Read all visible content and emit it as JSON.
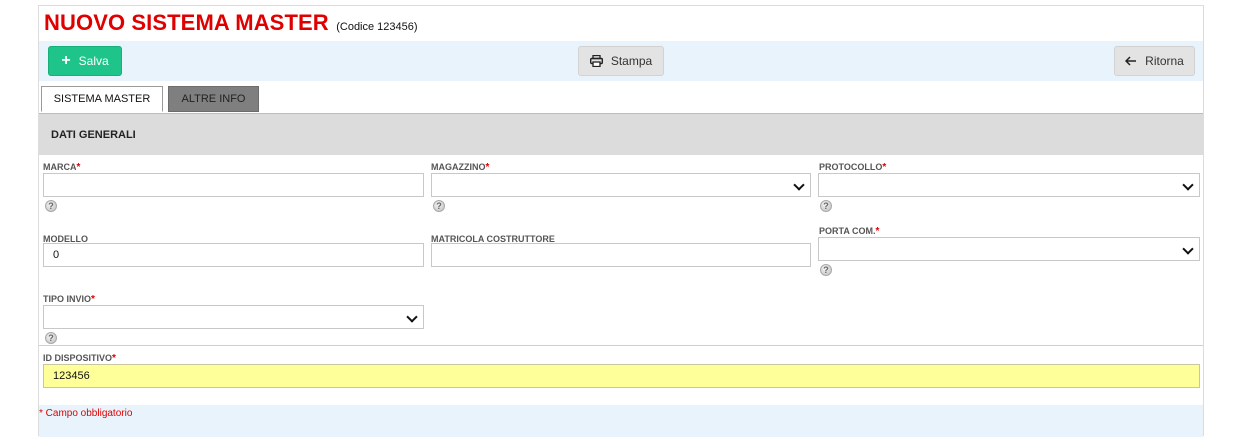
{
  "page": {
    "title": "NUOVO SISTEMA MASTER",
    "code": "(Codice 123456)"
  },
  "toolbar": {
    "save_label": "Salva",
    "print_label": "Stampa",
    "back_label": "Ritorna"
  },
  "tabs": [
    {
      "label": "SISTEMA MASTER",
      "active": true
    },
    {
      "label": "ALTRE INFO",
      "active": false
    }
  ],
  "section": {
    "title": "DATI GENERALI"
  },
  "fields": {
    "marca": {
      "label": "MARCA",
      "required": "*",
      "value": ""
    },
    "magazzino": {
      "label": "MAGAZZINO",
      "required": "*",
      "value": ""
    },
    "protocollo": {
      "label": "PROTOCOLLO",
      "required": "*",
      "value": ""
    },
    "modello": {
      "label": "MODELLO",
      "value": "0"
    },
    "matricola": {
      "label": "MATRICOLA COSTRUTTORE",
      "value": ""
    },
    "porta_com": {
      "label": "PORTA COM.",
      "required": "*",
      "value": ""
    },
    "tipo_invio": {
      "label": "TIPO INVIO",
      "required": "*",
      "value": ""
    },
    "id_dispositivo": {
      "label": "ID DISPOSITIVO",
      "required": "*",
      "value": "123456"
    }
  },
  "help_glyph": "?",
  "footnote": "* Campo obbligatorio",
  "colors": {
    "title": "#e00000",
    "save_button": "#1fc48a",
    "toolbar_bg": "#e8f3fb",
    "highlight_input": "#ffff99",
    "tab_inactive": "#7f7f7f"
  }
}
